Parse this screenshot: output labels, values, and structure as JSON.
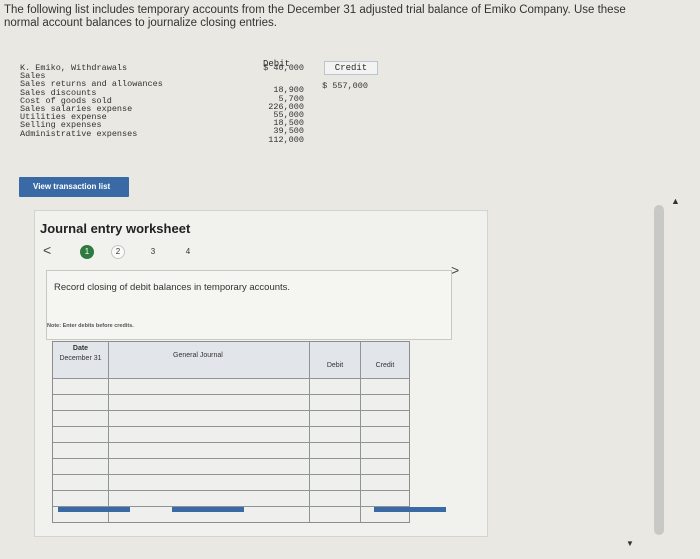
{
  "intro": "The following list includes temporary accounts from the December 31 adjusted trial balance of Emiko Company. Use these normal account balances to journalize closing entries.",
  "trial_balance": {
    "debit_header": "Debit",
    "credit_header": "Credit",
    "rows": [
      {
        "name": "K. Emiko, Withdrawals",
        "debit": "$ 40,000",
        "credit": ""
      },
      {
        "name": "Sales",
        "debit": "",
        "credit": "$ 557,000"
      },
      {
        "name": "Sales returns and allowances",
        "debit": "18,900",
        "credit": ""
      },
      {
        "name": "Sales discounts",
        "debit": "5,700",
        "credit": ""
      },
      {
        "name": "Cost of goods sold",
        "debit": "226,000",
        "credit": ""
      },
      {
        "name": "Sales salaries expense",
        "debit": "55,000",
        "credit": ""
      },
      {
        "name": "Utilities expense",
        "debit": "18,500",
        "credit": ""
      },
      {
        "name": "Selling expenses",
        "debit": "39,500",
        "credit": ""
      },
      {
        "name": "Administrative expenses",
        "debit": "112,000",
        "credit": ""
      }
    ]
  },
  "view_button": "View transaction list",
  "worksheet": {
    "title": "Journal entry worksheet",
    "nav_prev": "<",
    "nav_next": ">",
    "steps": [
      "1",
      "2",
      "3",
      "4"
    ],
    "active_step": "1",
    "instruction": "Record closing of debit balances in temporary accounts.",
    "note": "Note: Enter debits before credits.",
    "table": {
      "date_header": "Date",
      "journal_header": "General Journal",
      "debit_header": "Debit",
      "credit_header": "Credit",
      "date_value": "December 31"
    }
  },
  "colors": {
    "button_blue": "#3a6aa5",
    "step_active_green": "#2f7a3e"
  }
}
